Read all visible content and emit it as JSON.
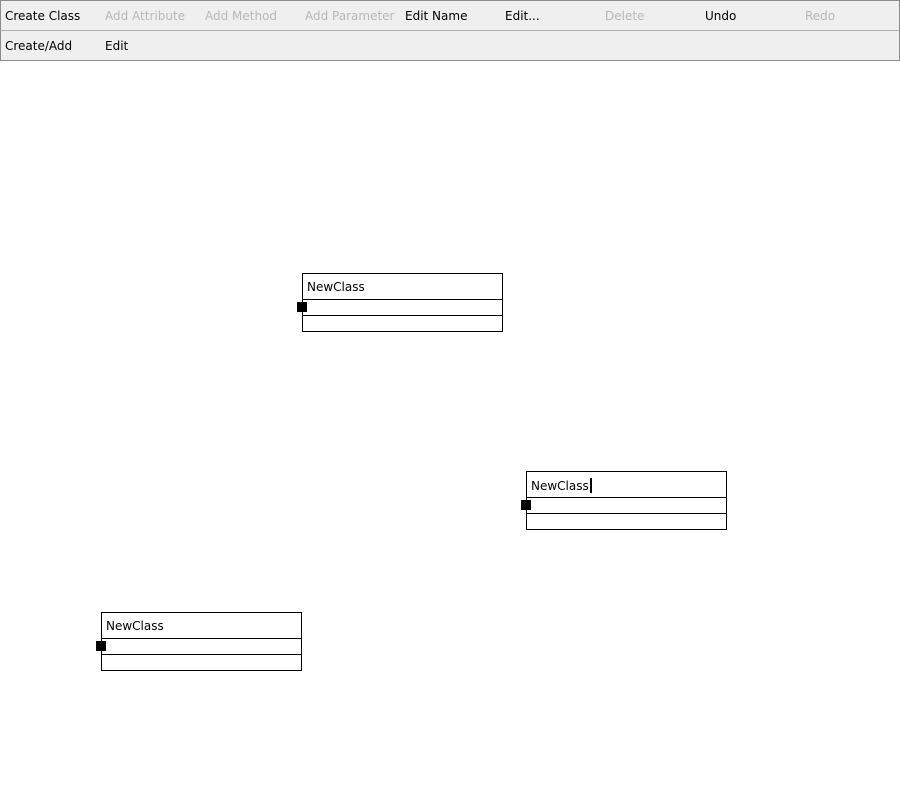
{
  "toolbar": {
    "row1": [
      {
        "label": "Create Class",
        "enabled": true
      },
      {
        "label": "Add Attribute",
        "enabled": false
      },
      {
        "label": "Add Method",
        "enabled": false
      },
      {
        "label": "Add Parameter",
        "enabled": false
      },
      {
        "label": "Edit Name",
        "enabled": true
      },
      {
        "label": "Edit...",
        "enabled": true
      },
      {
        "label": "Delete",
        "enabled": false
      },
      {
        "label": "Undo",
        "enabled": true
      },
      {
        "label": "Redo",
        "enabled": false
      }
    ],
    "row2": [
      {
        "label": "Create/Add",
        "enabled": true
      },
      {
        "label": "Edit",
        "enabled": true
      }
    ]
  },
  "canvas": {
    "classes": [
      {
        "name": "NewClass",
        "editing": false
      },
      {
        "name": "NewClass",
        "editing": true
      },
      {
        "name": "NewClass",
        "editing": false
      }
    ]
  },
  "colors": {
    "toolbar_bg": "#efefef",
    "disabled_text": "#b8b8b8",
    "border": "#000000"
  }
}
